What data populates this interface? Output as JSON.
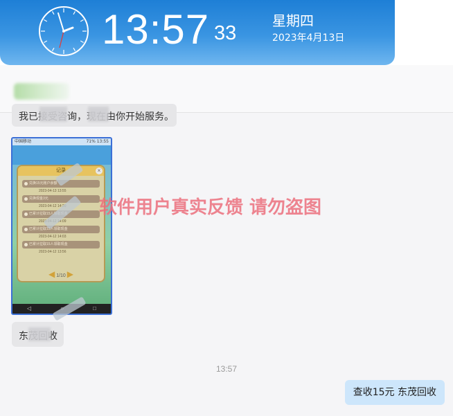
{
  "header": {
    "time_main": "13:57",
    "time_seconds": "33",
    "weekday": "星期四",
    "date": "2023年4月13日",
    "accent": "#1e7fd6"
  },
  "chat": {
    "contact_name_redacted": true,
    "messages": [
      {
        "side": "left",
        "type": "text",
        "text": "我已接受咨询，现在由你开始服务。"
      },
      {
        "side": "left",
        "type": "image",
        "screenshot": {
          "status_left": "中国移动",
          "status_right": "71% 13:55",
          "panel_title": "记录",
          "records": [
            {
              "label": "兑换15元账户余额",
              "time": "2023-04-13 13:55"
            },
            {
              "label": "兑换现金3元",
              "time": "2023-04-12 14:20"
            },
            {
              "label": "已累计拉取15人领取现金",
              "time": "2023-04-12 14:09"
            },
            {
              "label": "已累计拉取15人领取现金",
              "time": "2023-04-12 14:03"
            },
            {
              "label": "已累计拉取15人领取现金",
              "time": "2023-04-12 13:56"
            }
          ],
          "pager": "1/10",
          "nav_icons": [
            "back-icon",
            "home-icon",
            "recent-icon"
          ]
        }
      },
      {
        "side": "left",
        "type": "text",
        "text": "东茂回收"
      },
      {
        "side": "center",
        "type": "timestamp",
        "text": "13:57"
      },
      {
        "side": "right",
        "type": "text",
        "text": "查收15元 东茂回收"
      }
    ]
  },
  "watermark": "软件用户真实反馈  请勿盗图",
  "colors": {
    "chat_bg": "#f5f5f7",
    "left_bubble": "#e6e6e8",
    "right_bubble": "#cde6fb",
    "watermark": "#eb6e7d"
  }
}
